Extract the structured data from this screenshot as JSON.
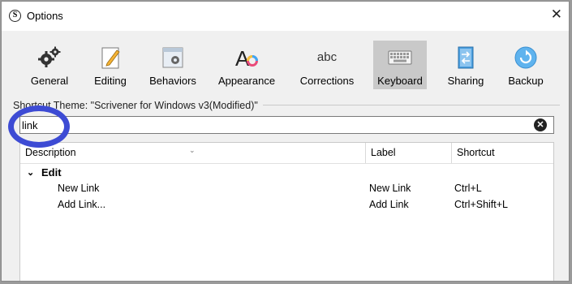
{
  "window": {
    "title": "Options",
    "app_icon_letter": "S",
    "close_glyph": "✕"
  },
  "toolbar": {
    "items": [
      {
        "label": "General",
        "icon": "gears-icon"
      },
      {
        "label": "Editing",
        "icon": "pencil-page-icon"
      },
      {
        "label": "Behaviors",
        "icon": "window-gear-icon"
      },
      {
        "label": "Appearance",
        "icon": "font-color-icon"
      },
      {
        "label": "Corrections",
        "icon": "abc-icon",
        "glyph": "abc"
      },
      {
        "label": "Keyboard",
        "icon": "keyboard-icon",
        "active": true
      },
      {
        "label": "Sharing",
        "icon": "sharing-icon"
      },
      {
        "label": "Backup",
        "icon": "backup-icon"
      }
    ]
  },
  "shortcut_theme": {
    "text": "Shortcut Theme: \"Scrivener for Windows v3(Modified)\""
  },
  "search": {
    "value": "link",
    "clear_glyph": "✕"
  },
  "table": {
    "columns": [
      "Description",
      "Label",
      "Shortcut"
    ],
    "group": {
      "name": "Edit",
      "chevron": "⌄"
    },
    "rows": [
      {
        "description": "New Link",
        "label": "New Link",
        "shortcut": "Ctrl+L"
      },
      {
        "description": "Add Link...",
        "label": "Add Link",
        "shortcut": "Ctrl+Shift+L"
      }
    ]
  },
  "colors": {
    "highlight_circle": "#3d4bd4",
    "active_tab_bg": "#c9c9c9"
  }
}
